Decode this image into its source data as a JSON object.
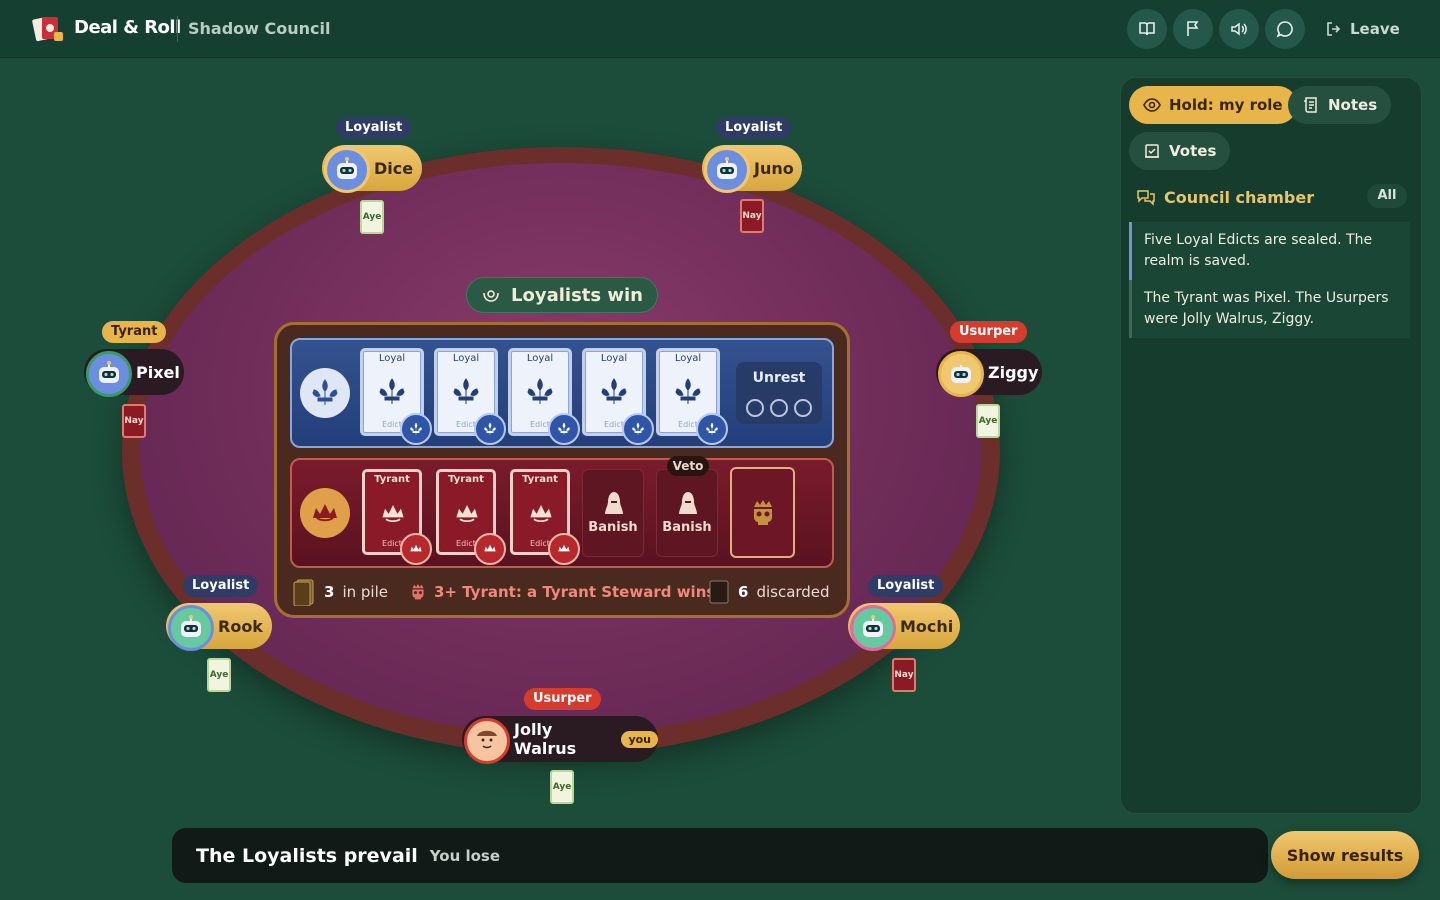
{
  "app": {
    "brand": "Deal & Roll",
    "game_name": "Shadow Council",
    "leave_label": "Leave"
  },
  "toolbar": {
    "icons": [
      "book-icon",
      "flag-icon",
      "sound-icon",
      "chat-icon"
    ]
  },
  "banner": {
    "text": "Loyalists win"
  },
  "board": {
    "loyal_cards": [
      {
        "title": "Loyal",
        "sub": "Edict"
      },
      {
        "title": "Loyal",
        "sub": "Edict"
      },
      {
        "title": "Loyal",
        "sub": "Edict"
      },
      {
        "title": "Loyal",
        "sub": "Edict"
      },
      {
        "title": "Loyal",
        "sub": "Edict"
      }
    ],
    "unrest": {
      "label": "Unrest",
      "filled": 0,
      "total": 3
    },
    "tyrant_cards": [
      {
        "title": "Tyrant",
        "sub": "Edict"
      },
      {
        "title": "Tyrant",
        "sub": "Edict"
      },
      {
        "title": "Tyrant",
        "sub": "Edict"
      }
    ],
    "power_slots": [
      {
        "label": "Banish"
      },
      {
        "label": "Banish"
      }
    ],
    "veto_label": "Veto",
    "pile_count": "3",
    "pile_label": "in pile",
    "rule_text": "3+ Tyrant: a Tyrant Steward wins",
    "discard_count": "6",
    "discard_label": "discarded"
  },
  "players": [
    {
      "name": "Dice",
      "role": "Loyalist",
      "vote": "Aye"
    },
    {
      "name": "Juno",
      "role": "Loyalist",
      "vote": "Nay"
    },
    {
      "name": "Pixel",
      "role": "Tyrant",
      "vote": "Nay"
    },
    {
      "name": "Ziggy",
      "role": "Usurper",
      "vote": "Aye"
    },
    {
      "name": "Rook",
      "role": "Loyalist",
      "vote": "Aye"
    },
    {
      "name": "Mochi",
      "role": "Loyalist",
      "vote": "Nay"
    },
    {
      "name": "Jolly Walrus",
      "role": "Usurper",
      "vote": "Aye",
      "badge": "you"
    }
  ],
  "panel": {
    "tabs": [
      "Hold: my role",
      "Notes",
      "Votes"
    ],
    "chamber_title": "Council chamber",
    "filter_label": "All",
    "messages": [
      "Five Loyal Edicts are sealed. The realm is saved.",
      "The Tyrant was Pixel. The Usurpers were Jolly Walrus, Ziggy."
    ]
  },
  "result": {
    "title": "The Loyalists prevail",
    "subtitle": "You lose",
    "button": "Show results"
  },
  "colors": {
    "felt": "#7a3263",
    "background": "#1c4d3a",
    "gold": "#e8b54a",
    "loyal": "#2e4f93",
    "tyrant": "#8b1a28"
  }
}
